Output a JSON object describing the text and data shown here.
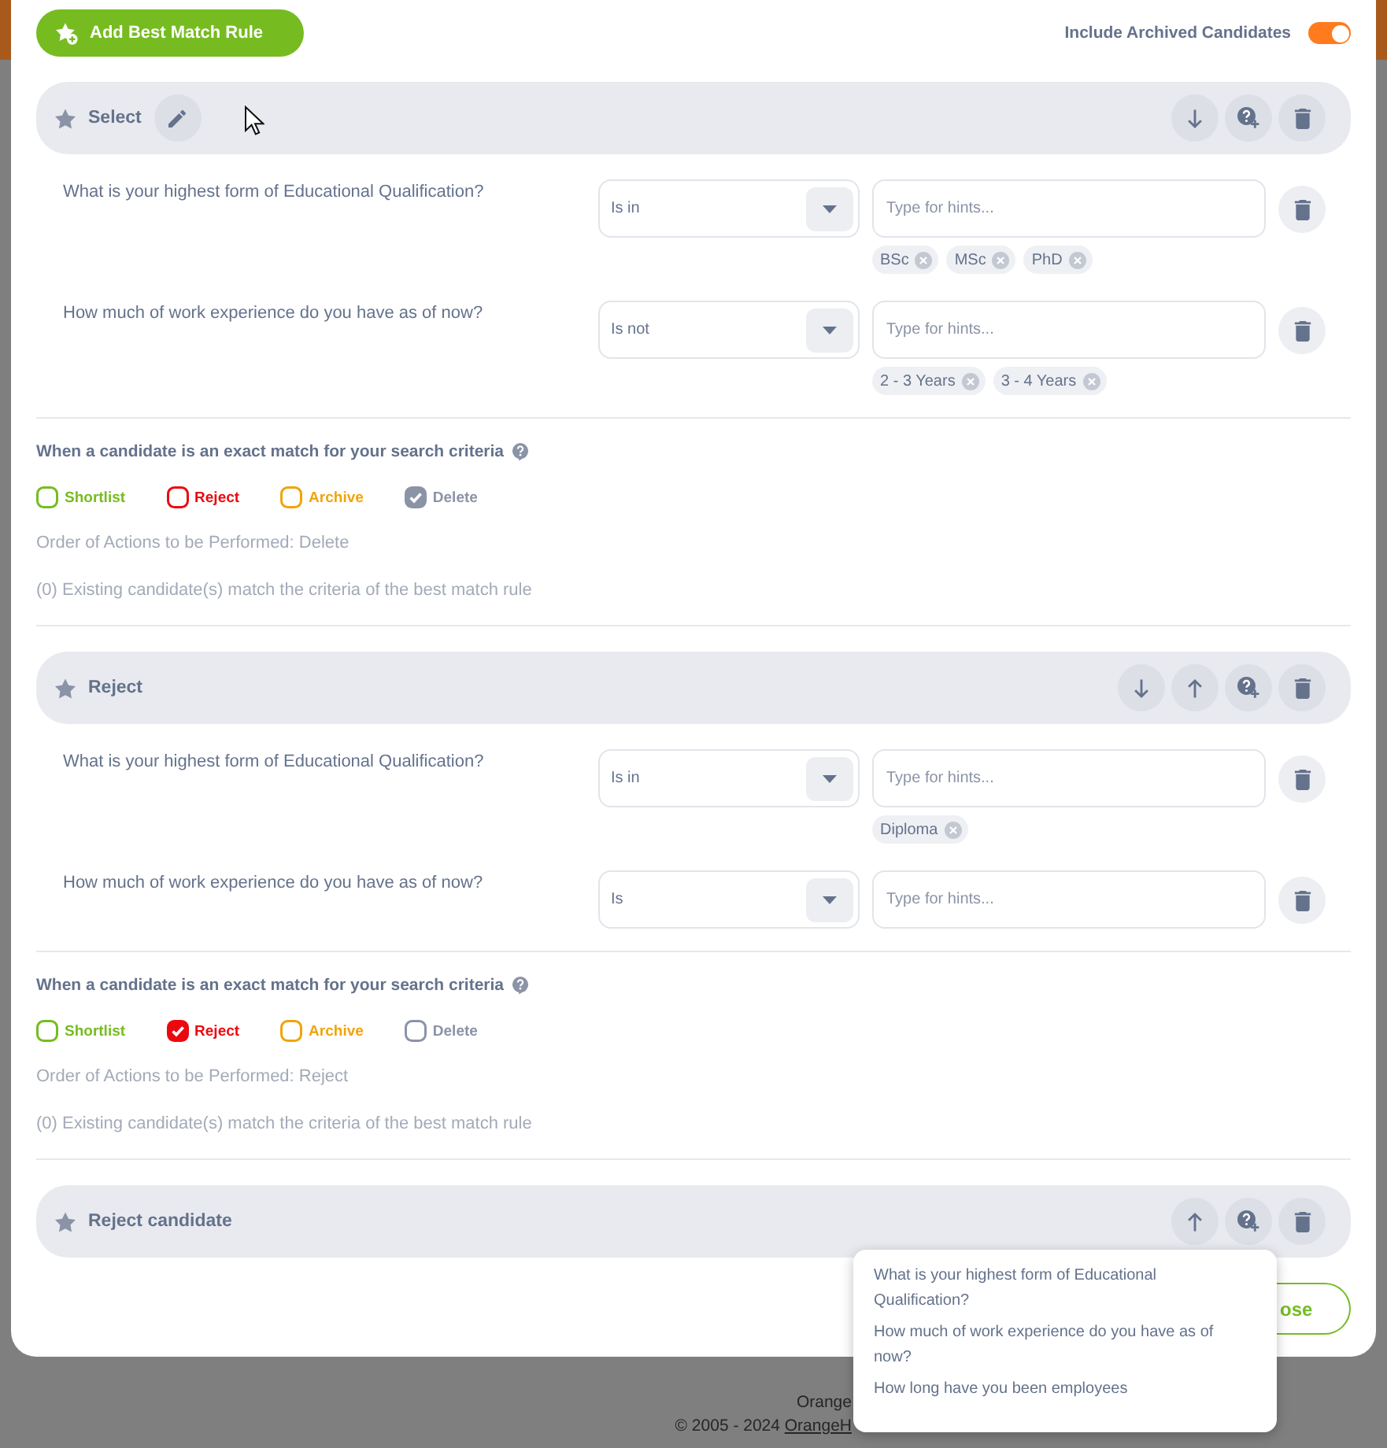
{
  "add_rule_button": {
    "label": "Add Best Match Rule"
  },
  "include_archived": {
    "label": "Include Archived Candidates",
    "on": true
  },
  "rules": [
    {
      "title": "Select",
      "edit_button": true,
      "controls": [
        {
          "kind": "move-down"
        },
        {
          "kind": "add-question"
        },
        {
          "kind": "delete"
        }
      ],
      "criteria": [
        {
          "question": "What is your highest form of Educational Qualification?",
          "operator": "Is in",
          "placeholder": "Type for hints...",
          "tags": [
            "BSc",
            "MSc",
            "PhD"
          ]
        },
        {
          "question": "How much of work experience do you have as of now?",
          "operator": "Is not",
          "placeholder": "Type for hints...",
          "tags": [
            "2 - 3 Years",
            "3 - 4 Years"
          ]
        }
      ],
      "actions": {
        "heading": "When a candidate is an exact match for your search criteria",
        "options": [
          {
            "label": "Shortlist",
            "color": "#76bc21",
            "checked": false
          },
          {
            "label": "Reject",
            "color": "#eb0910",
            "checked": false
          },
          {
            "label": "Archive",
            "color": "#f0a40b",
            "checked": false
          },
          {
            "label": "Delete",
            "color": "#8b93a7",
            "checked": true
          }
        ],
        "order_text": "Order of Actions to be Performed: Delete",
        "match_text": "(0) Existing candidate(s) match the criteria of the best match rule"
      }
    },
    {
      "title": "Reject",
      "edit_button": false,
      "controls": [
        {
          "kind": "move-down"
        },
        {
          "kind": "move-up"
        },
        {
          "kind": "add-question"
        },
        {
          "kind": "delete"
        }
      ],
      "criteria": [
        {
          "question": "What is your highest form of Educational Qualification?",
          "operator": "Is in",
          "placeholder": "Type for hints...",
          "tags": [
            "Diploma"
          ]
        },
        {
          "question": "How much of work experience do you have as of now?",
          "operator": "Is",
          "placeholder": "Type for hints..."
        }
      ],
      "actions": {
        "heading": "When a candidate is an exact match for your search criteria",
        "options": [
          {
            "label": "Shortlist",
            "color": "#76bc21",
            "checked": false
          },
          {
            "label": "Reject",
            "color": "#eb0910",
            "checked": true
          },
          {
            "label": "Archive",
            "color": "#f0a40b",
            "checked": false
          },
          {
            "label": "Delete",
            "color": "#8b93a7",
            "checked": false
          }
        ],
        "order_text": "Order of Actions to be Performed: Reject",
        "match_text": "(0) Existing candidate(s) match the criteria of the best match rule"
      }
    },
    {
      "title": "Reject candidate",
      "edit_button": false,
      "controls": [
        {
          "kind": "move-up"
        },
        {
          "kind": "add-question"
        },
        {
          "kind": "delete"
        }
      ]
    }
  ],
  "close_button": {
    "label": "ose"
  },
  "question_menu": {
    "items": [
      "What is your highest form of Educational Qualification?",
      "How much of work experience do you have as of now?",
      "How long have you been employees"
    ]
  },
  "footer": {
    "line": "Orange",
    "copyright": "© 2005 - 2024",
    "link": "OrangeH"
  }
}
